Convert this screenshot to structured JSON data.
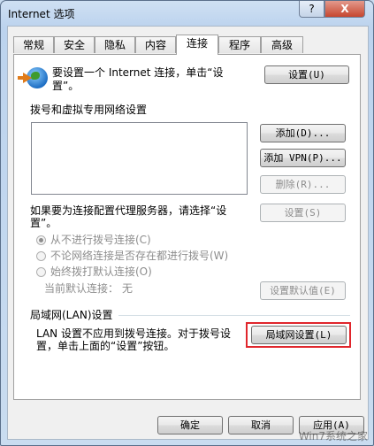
{
  "window": {
    "title": "Internet 选项",
    "help_glyph": "?",
    "close_glyph": "X"
  },
  "tabs": [
    {
      "label": "常规"
    },
    {
      "label": "安全"
    },
    {
      "label": "隐私"
    },
    {
      "label": "内容"
    },
    {
      "label": "连接",
      "active": true
    },
    {
      "label": "程序"
    },
    {
      "label": "高级"
    }
  ],
  "setup": {
    "text_line1": "要设置一个 Internet 连接，单击“设",
    "text_line2": "置”。",
    "button": "设置(U)"
  },
  "dialup": {
    "section_label": "拨号和虚拟专用网络设置",
    "add_button": "添加(D)...",
    "add_vpn_button": "添加 VPN(P)...",
    "delete_button": "删除(R)...",
    "proxy_text_line1": "如果要为连接配置代理服务器，请选择“设",
    "proxy_text_line2": "置”。",
    "settings_button": "设置(S)",
    "radio_never": "从不进行拨号连接(C)",
    "radio_when_no_network": "不论网络连接是否存在都进行拨号(W)",
    "radio_always": "始终拨打默认连接(O)",
    "current_default": "当前默认连接：",
    "current_default_value": "无",
    "set_default_button": "设置默认值(E)"
  },
  "lan": {
    "section_label": "局域网(LAN)设置",
    "text_line1": "LAN 设置不应用到拨号连接。对于拨号设",
    "text_line2": "置，单击上面的“设置”按钮。",
    "button": "局域网设置(L)"
  },
  "footer": {
    "ok": "确定",
    "cancel": "取消",
    "apply": "应用(A)"
  },
  "watermark": "Win7系统之家"
}
